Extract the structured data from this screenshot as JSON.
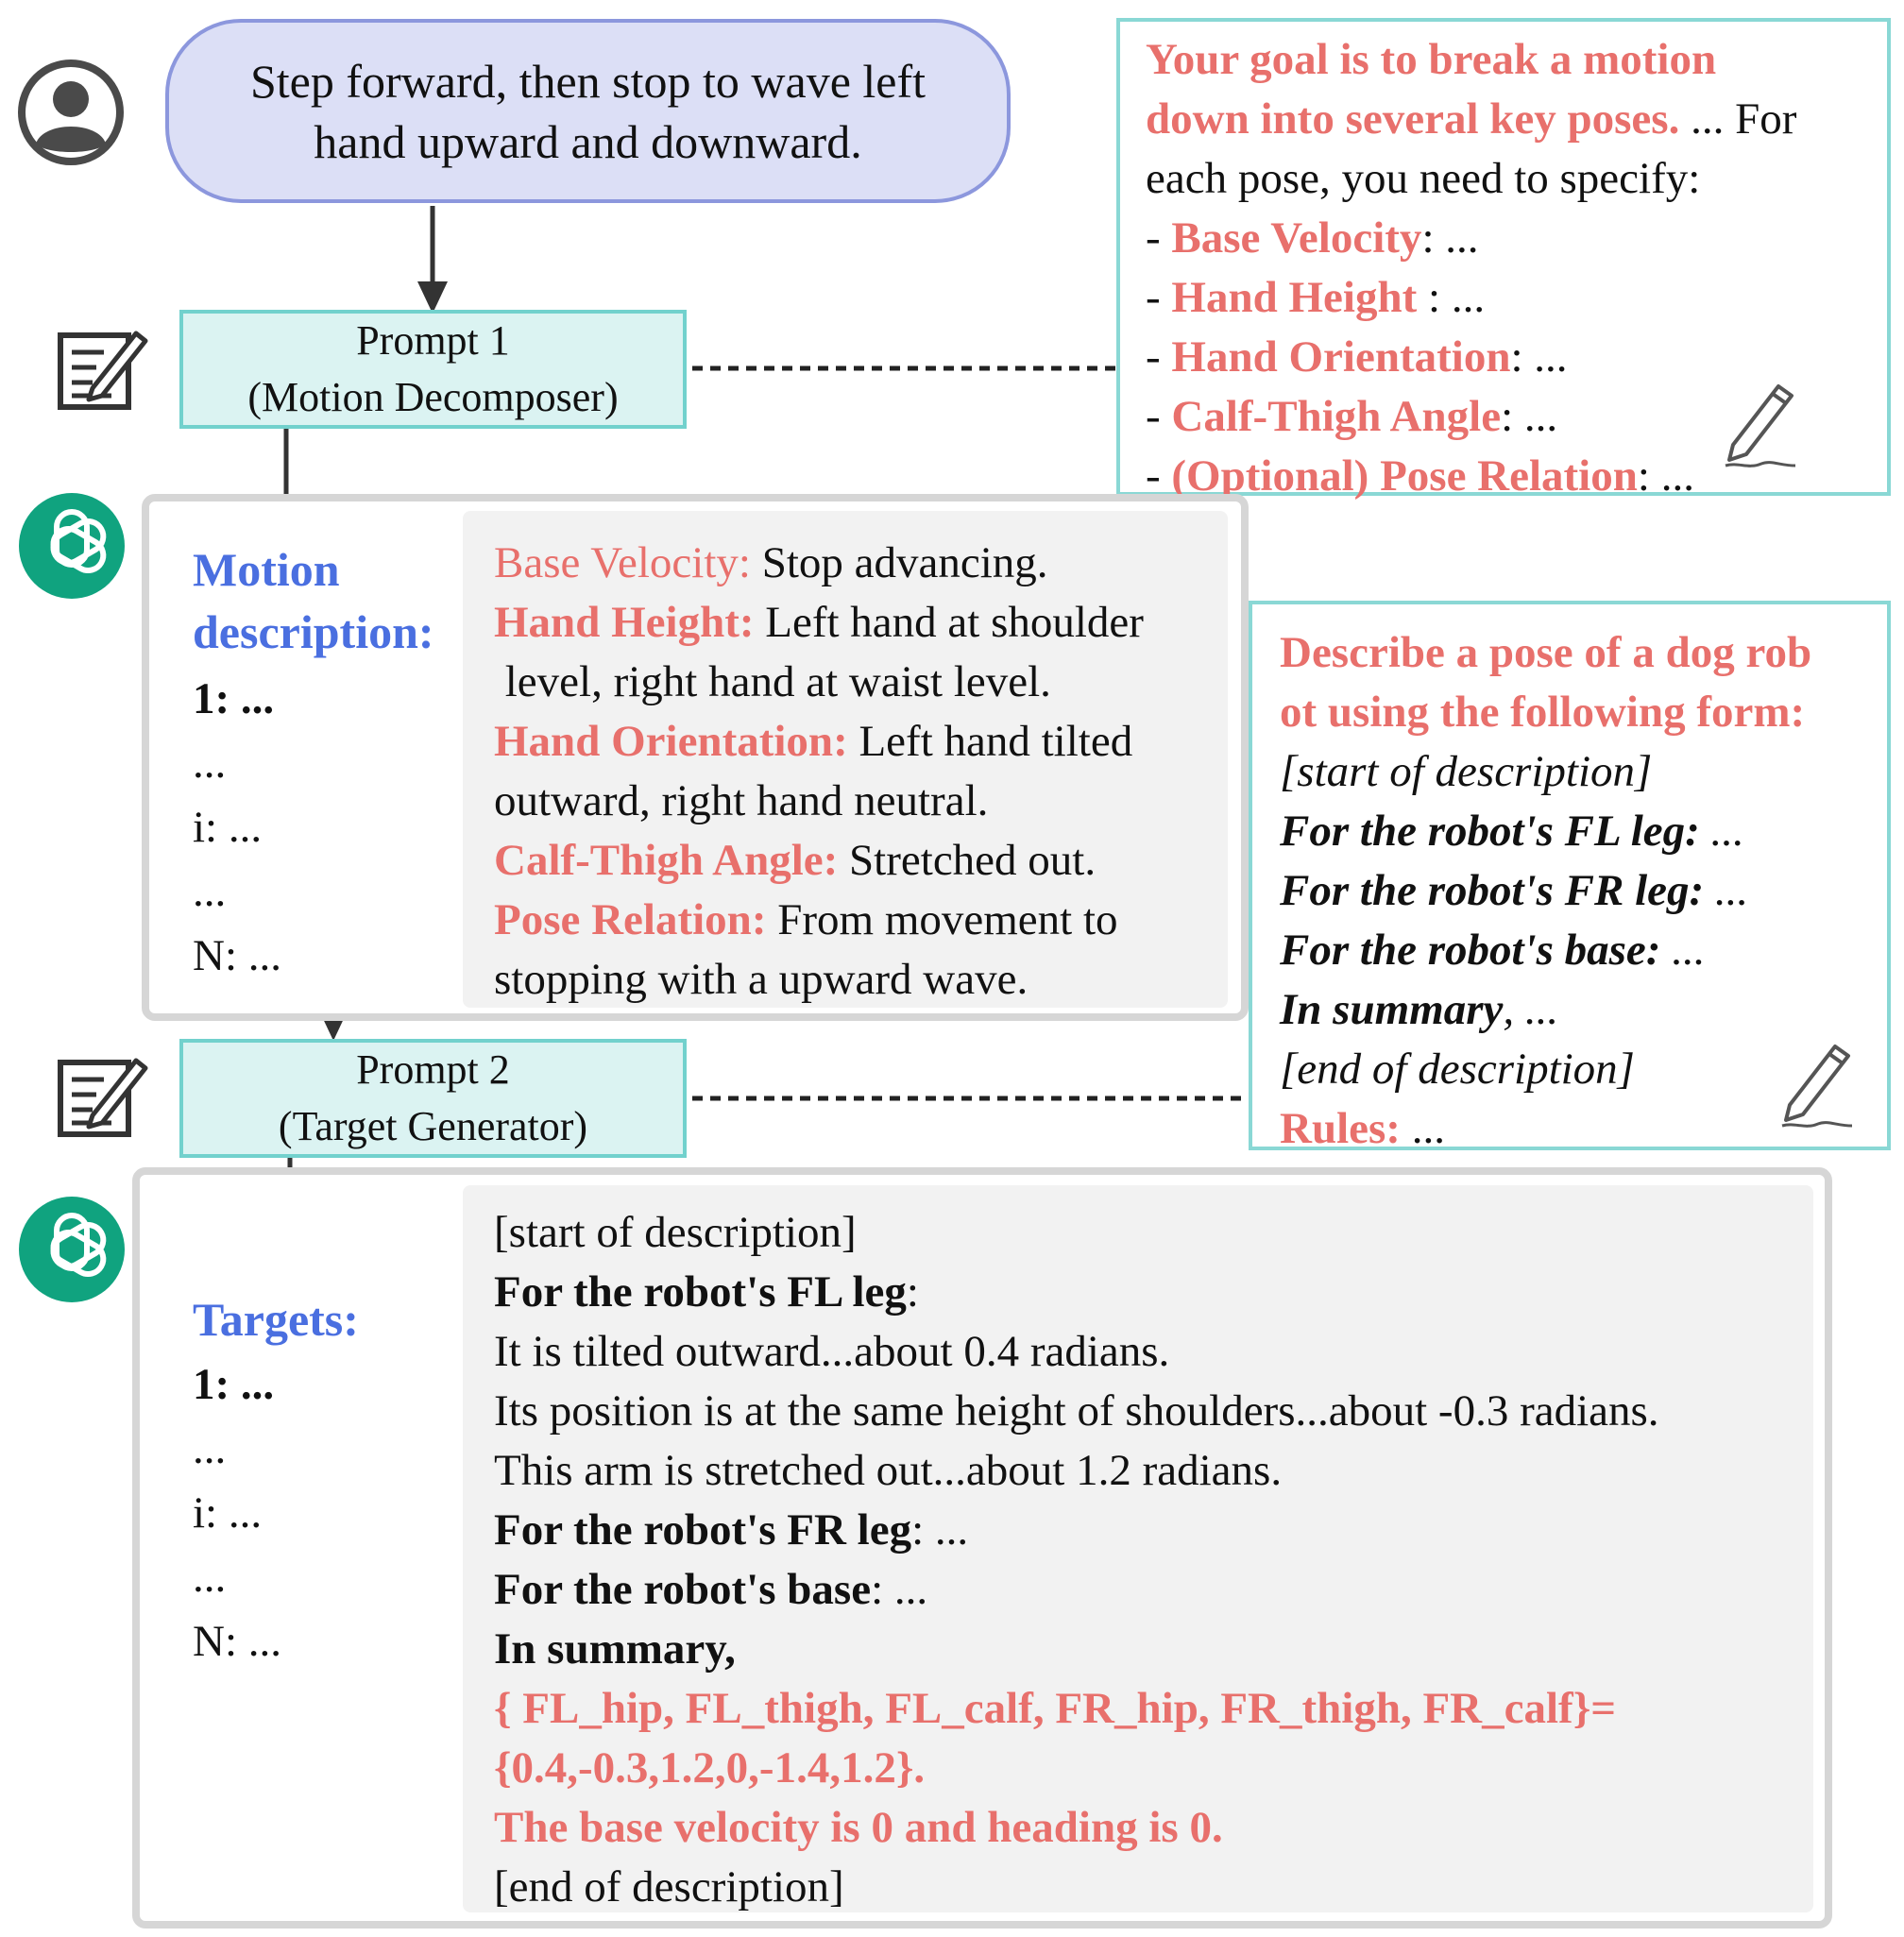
{
  "user_instruction": {
    "lines": [
      "Step forward, then stop to wave left",
      "hand upward and downward."
    ]
  },
  "prompt1": {
    "title": "Prompt 1",
    "subtitle": "(Motion Decomposer)",
    "text": {
      "goal_line1": "Your goal is to break a motion",
      "goal_line2": "down into several key poses.",
      "goal_cont": " ... For",
      "line3": "each pose, you need to specify:",
      "bullet_prefix": "- ",
      "items": [
        {
          "label": "Base Velocity",
          "suffix": ": ..."
        },
        {
          "label": "Hand Height",
          "suffix": " : ..."
        },
        {
          "label": "Hand Orientation",
          "suffix": ": ..."
        },
        {
          "label": "Calf-Thigh Angle",
          "suffix": ": ..."
        },
        {
          "label": "(Optional) Pose Relation",
          "suffix": ": ..."
        }
      ]
    }
  },
  "motion": {
    "heading_line1": "Motion",
    "heading_line2": "description:",
    "index": [
      "1: ...",
      "...",
      "i: ...",
      "...",
      "N: ..."
    ],
    "detail": {
      "base_velocity_label": "Base Velocity:",
      "base_velocity_value": " Stop advancing.",
      "hand_height_label": "Hand Height:",
      "hand_height_value": " Left hand at shoulder",
      "hand_height_value2": " level, right hand at waist level.",
      "hand_orientation_label": "Hand Orientation:",
      "hand_orientation_value": " Left hand tilted",
      "hand_orientation_value2": "outward, right hand neutral.",
      "calf_thigh_label": "Calf-Thigh Angle:",
      "calf_thigh_value": " Stretched out.",
      "pose_relation_label": "Pose Relation:",
      "pose_relation_value": " From movement to",
      "pose_relation_value2": "stopping with a upward wave."
    }
  },
  "prompt2": {
    "title": "Prompt 2",
    "subtitle": "(Target Generator)",
    "text": {
      "line1": "Describe a pose of a dog rob",
      "line2": "ot using the following form:",
      "line3": "[start of description]",
      "fl_label": "For the robot's FL leg:",
      "fl_suffix": " ...",
      "fr_label": "For the robot's FR leg:",
      "fr_suffix": " ...",
      "base_label": "For the robot's base:",
      "base_suffix": " ...",
      "summary_label": "In summary",
      "summary_suffix": ", ...",
      "end": "[end of description]",
      "rules_label": "Rules:",
      "rules_suffix": " ..."
    }
  },
  "targets": {
    "heading": "Targets:",
    "index": [
      "1: ...",
      "...",
      "i: ...",
      "...",
      "N: ..."
    ],
    "detail": {
      "start": "[start of description]",
      "fl_label": "For the robot's FL leg",
      "fl_colon": ":",
      "fl_l1": "It is tilted outward...about 0.4 radians.",
      "fl_l2": "Its position is at the same height of shoulders...about -0.3 radians.",
      "fl_l3": "This arm is stretched out...about 1.2 radians.",
      "fr_label": "For the robot's FR leg",
      "fr_suffix": ": ...",
      "base_label": "For the robot's base",
      "base_suffix": ": ...",
      "summary": "In summary,",
      "code1": "{ FL_hip, FL_thigh, FL_calf, FR_hip, FR_thigh, FR_calf}=",
      "code2": "{0.4,-0.3,1.2,0,-1.4,1.2}.",
      "velocity": "The base velocity is 0 and heading is 0.",
      "end": "[end of description]"
    }
  },
  "colors": {
    "red": "#e8706c",
    "blue": "#4a6fe0",
    "teal_border": "#72d1cd",
    "teal_fill": "#dbf3f2",
    "bubble_fill": "#dcdff6",
    "bubble_border": "#8c97dd",
    "gpt_green": "#10a37f"
  }
}
